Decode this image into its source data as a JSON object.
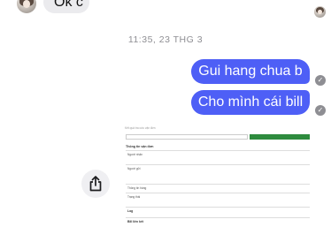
{
  "incoming": {
    "text": "Ok c"
  },
  "timestamp": "11:35, 23 THG 3",
  "outgoing": [
    {
      "text": "Gui hang chua b"
    },
    {
      "text": "Cho mình cái bill"
    }
  ],
  "seen_glyph": "✓",
  "share": {
    "icon": "share-icon"
  },
  "attachment": {
    "note": "Kết quả tra cứu vận đơn",
    "search_value": "",
    "search_button": "",
    "header": "Thông tin vận đơn",
    "rows": [
      {
        "label": "Người nhận",
        "value": ""
      },
      {
        "label": "Người gửi",
        "value": ""
      },
      {
        "label": "Thông tin hàng",
        "value": ""
      },
      {
        "label": "Trạng thái",
        "value": "",
        "status": ""
      }
    ],
    "sections": [
      "Log",
      "Bill liên kết"
    ]
  },
  "colors": {
    "outgoing_bubble": "#4e5ff6",
    "incoming_bubble": "#ebebee",
    "timestamp": "#8e8e93"
  }
}
